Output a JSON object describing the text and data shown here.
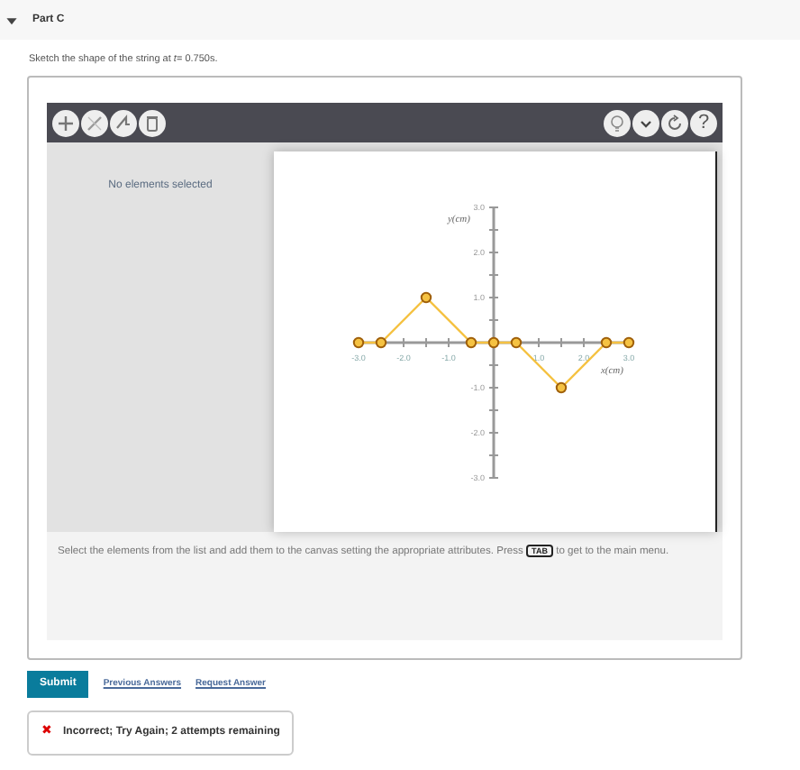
{
  "part": {
    "title": "Part C",
    "expanded": true
  },
  "prompt": "Sketch the shape of the string at *t*= 0.750s.",
  "toolbar": {
    "left": [
      {
        "kind": "add"
      },
      {
        "kind": "edit"
      },
      {
        "kind": "wand"
      },
      {
        "kind": "delete"
      }
    ],
    "right": [
      {
        "kind": "hint"
      },
      {
        "kind": "more"
      },
      {
        "kind": "reset"
      },
      {
        "kind": "help",
        "label": "?"
      }
    ]
  },
  "side_panel": {
    "message": "No elements selected"
  },
  "chart_data": {
    "type": "line",
    "xlabel": "x(cm)",
    "ylabel": "y(cm)",
    "xlim": [
      -3,
      3
    ],
    "ylim": [
      -3,
      3
    ],
    "xticks": [
      {
        "value": -3,
        "label": "-3.0"
      },
      {
        "value": -2,
        "label": "-2.0"
      },
      {
        "value": -1,
        "label": "-1.0"
      },
      {
        "value": 1,
        "label": "1.0"
      },
      {
        "value": 2,
        "label": "2.0"
      },
      {
        "value": 3,
        "label": "3.0"
      }
    ],
    "yticks": [
      {
        "value": 3,
        "label": "3.0"
      },
      {
        "value": 2,
        "label": "2.0"
      },
      {
        "value": 1,
        "label": "1.0"
      },
      {
        "value": -1,
        "label": "-1.0"
      },
      {
        "value": -2,
        "label": "-2.0"
      },
      {
        "value": -3,
        "label": "-3.0"
      }
    ],
    "x": [
      -3,
      -2.5,
      -1.5,
      -0.5,
      0,
      0.5,
      1.5,
      2.5,
      3
    ],
    "series": [
      {
        "color": "#f5c242",
        "marker": "circle",
        "values": [
          0,
          0,
          1,
          0,
          0,
          0,
          -1,
          0,
          0
        ]
      }
    ]
  },
  "instructions": {
    "before": "Select the elements from the list and add them to the canvas setting the appropriate attributes. Press",
    "key": "TAB",
    "after": "to get to the main menu."
  },
  "actions": {
    "submit": "Submit",
    "links": [
      "Previous Answers",
      "Request Answer"
    ]
  },
  "feedback": {
    "kind": "incorrect",
    "icon": "✖",
    "text": "Incorrect; Try Again; 2 attempts remaining"
  }
}
